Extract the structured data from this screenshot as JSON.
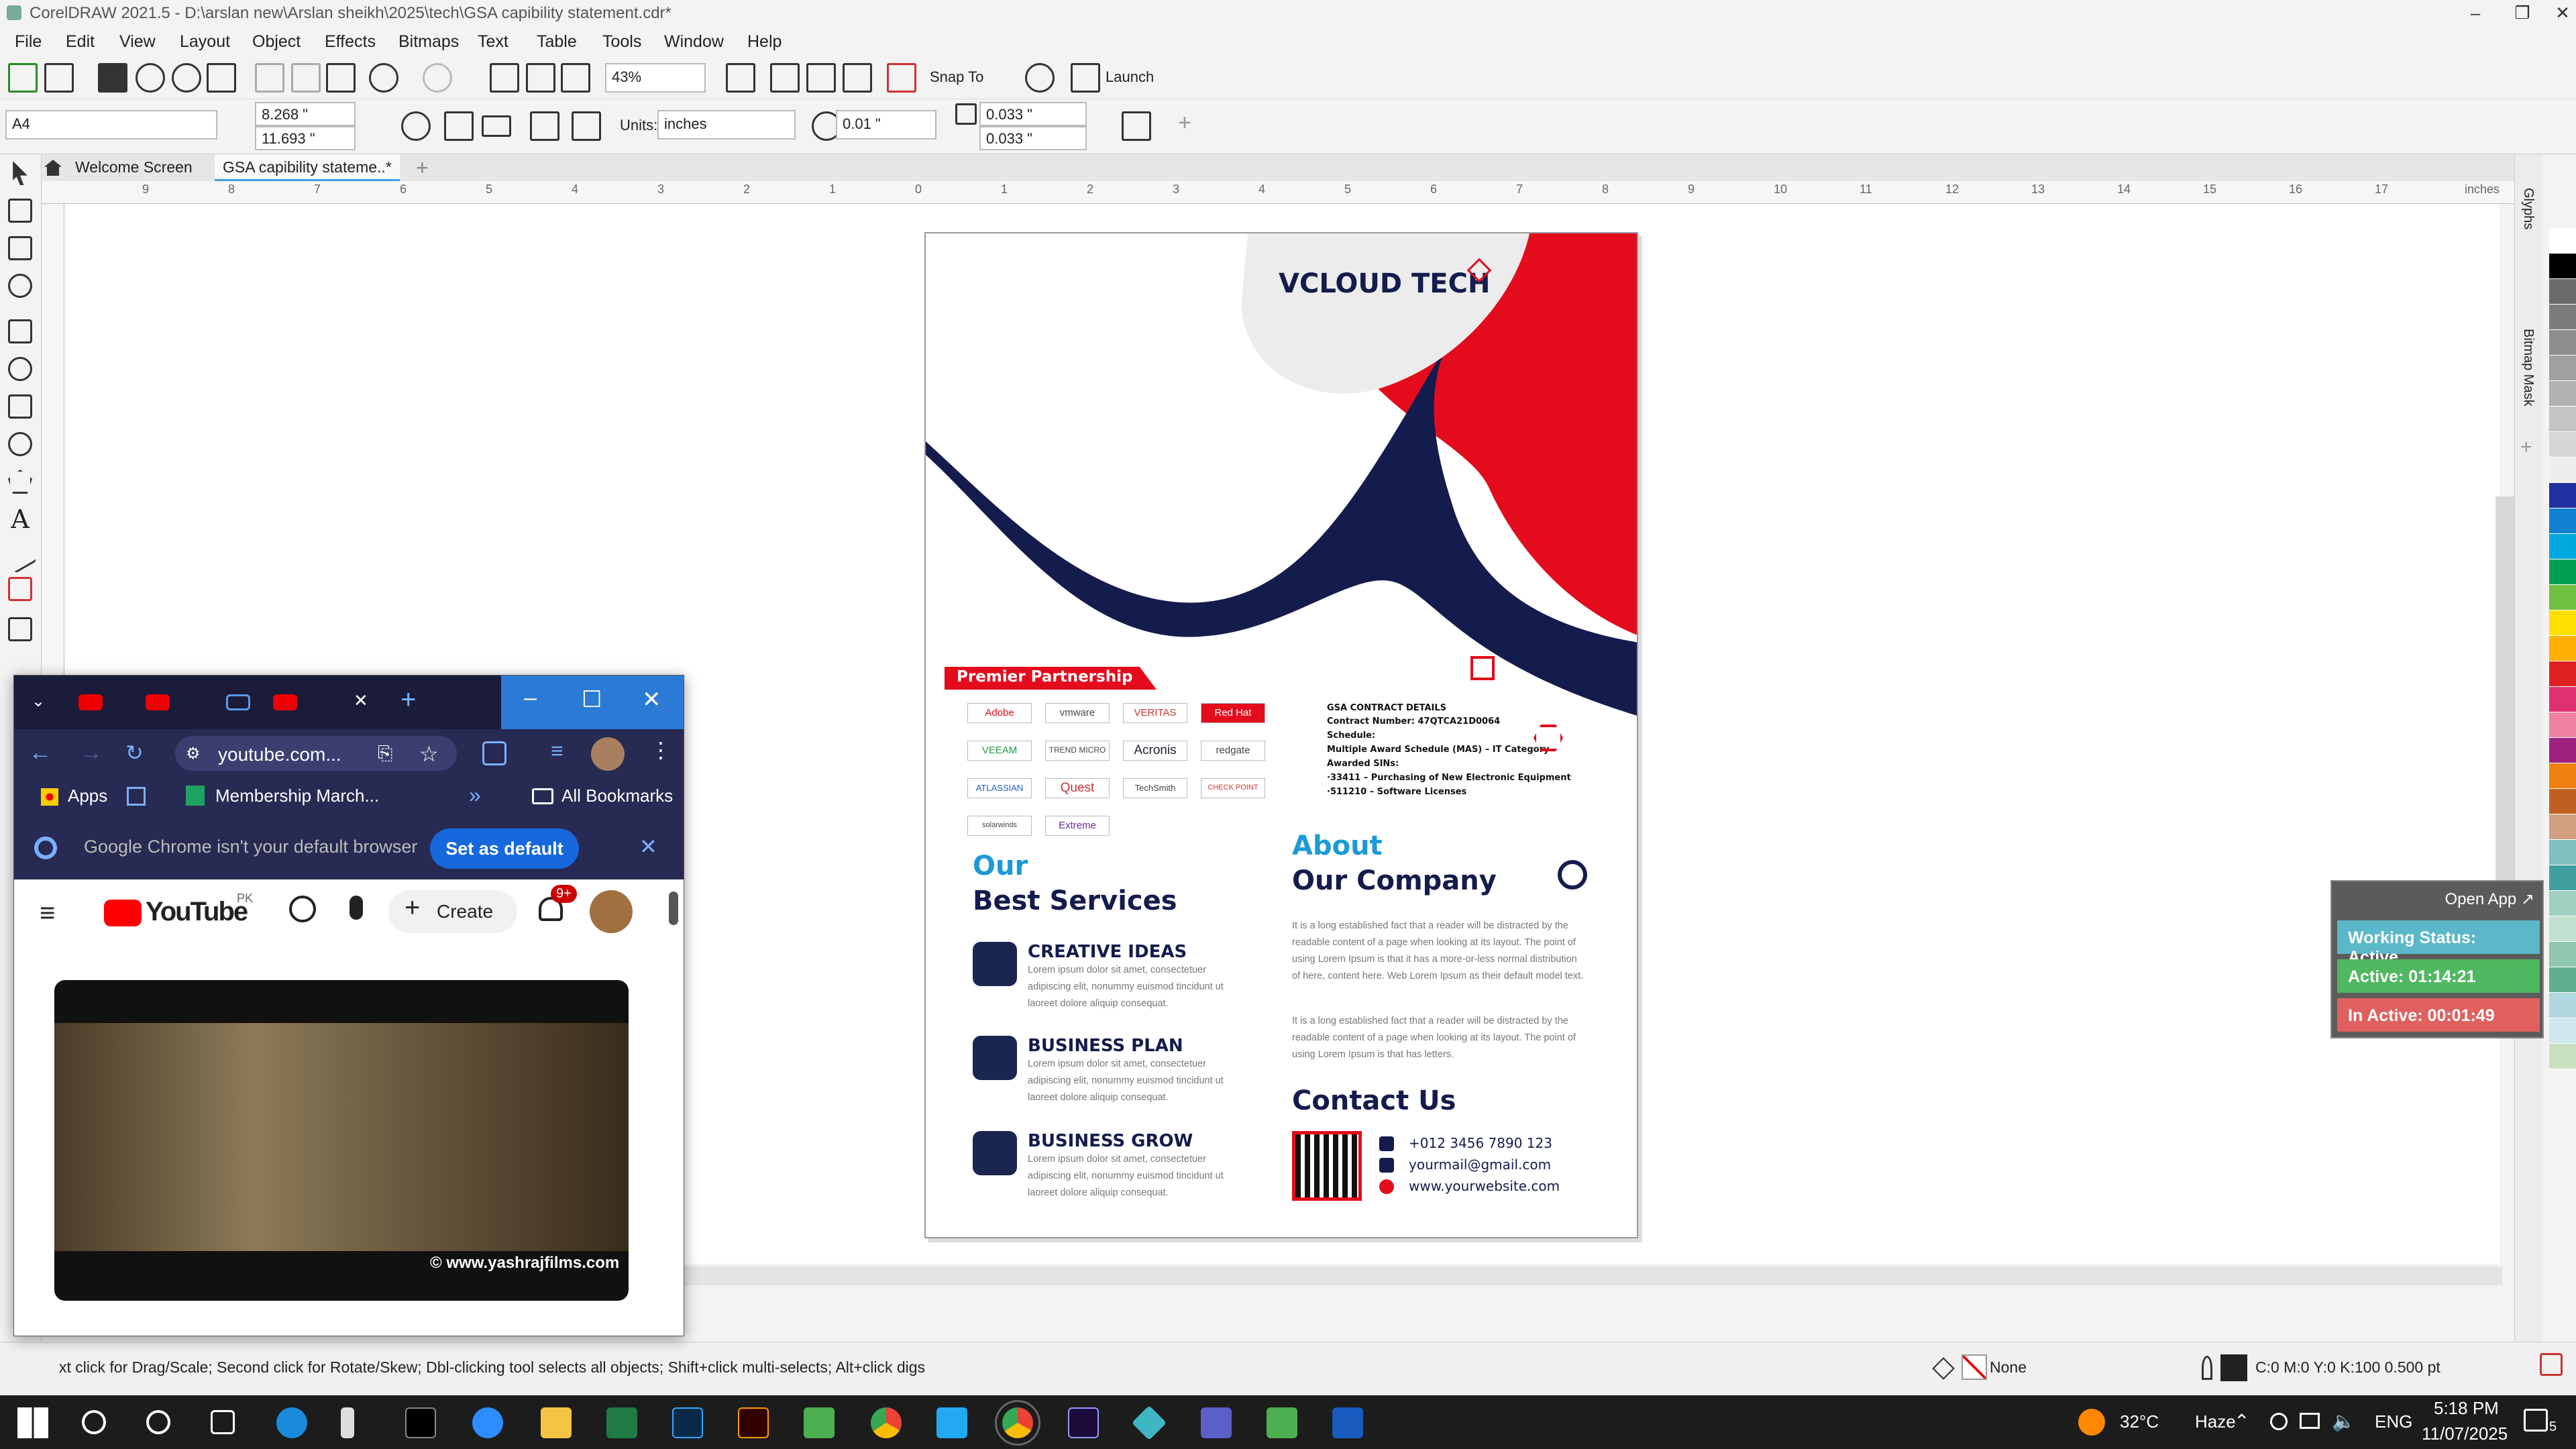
{
  "app": {
    "title": "CorelDRAW 2021.5 - D:\\arslan new\\Arslan sheikh\\2025\\tech\\GSA  capibility statement.cdr*"
  },
  "menu": [
    "File",
    "Edit",
    "View",
    "Layout",
    "Object",
    "Effects",
    "Bitmaps",
    "Text",
    "Table",
    "Tools",
    "Window",
    "Help"
  ],
  "toolbar": {
    "zoom": "43%",
    "snap_to": "Snap To",
    "launch": "Launch"
  },
  "propbar": {
    "page_size": "A4",
    "width": "8.268 \"",
    "height": "11.693 \"",
    "units_label": "Units:",
    "units": "inches",
    "nudge": "0.01 \"",
    "dup_x": "0.033 \"",
    "dup_y": "0.033 \""
  },
  "doc_tabs": [
    "Welcome Screen",
    "GSA  capibility stateme..*"
  ],
  "ruler_labels": [
    "9",
    "8",
    "7",
    "6",
    "5",
    "4",
    "3",
    "2",
    "1",
    "0",
    "1",
    "2",
    "3",
    "4",
    "5",
    "6",
    "7",
    "8",
    "9",
    "10",
    "11",
    "12",
    "13",
    "14",
    "15",
    "16",
    "17",
    "inches"
  ],
  "dockers": [
    "Glyphs",
    "Bitmap Mask"
  ],
  "palette_colors": [
    "#ffffff",
    "#000000",
    "#6a6a6a",
    "#7c7c7c",
    "#8e8e8e",
    "#a0a0a0",
    "#b2b2b2",
    "#c4c4c4",
    "#d6d6d6",
    "#eeeeee",
    "#2030a0",
    "#1080d0",
    "#00a8e0",
    "#00a050",
    "#70c040",
    "#ffe000",
    "#ffb000",
    "#e02020",
    "#e03070",
    "#f080a0",
    "#a02080",
    "#f08010",
    "#c06020",
    "#d0a080",
    "#80c0c0",
    "#40a0a0",
    "#a0d0c0",
    "#c0e0d0",
    "#90c8b0",
    "#60b090",
    "#b0d8e0",
    "#d0e8f0",
    "#c8e0c0"
  ],
  "status": {
    "hint": "xt click for Drag/Scale; Second click for Rotate/Skew; Dbl-clicking tool selects all objects; Shift+click multi-selects; Alt+click digs",
    "fill": "None",
    "outline": "C:0 M:0 Y:0 K:100  0.500 pt"
  },
  "taskbar": {
    "weather_temp": "32°C",
    "weather": "Haze",
    "lang": "ENG",
    "time": "5:18 PM",
    "date": "11/07/2025",
    "notif": "5"
  },
  "chrome": {
    "url": "youtube.com...",
    "bm_apps": "Apps",
    "bm_item": "Membership March...",
    "bm_all": "All Bookmarks",
    "info": "Google Chrome isn't your default browser",
    "set_default": "Set as default",
    "yt_brand": "YouTube",
    "yt_region": "PK",
    "yt_create": "Create",
    "yt_notif": "9+",
    "video_watermark": "© www.yashrajfilms.com"
  },
  "tracker": {
    "open_app": "Open App ↗",
    "status": "Working Status: Active",
    "active": "Active: 01:14:21",
    "inactive": "In Active: 00:01:49"
  },
  "doc": {
    "logo": "VCLOUD TECH",
    "partnership": "Premier Partnership",
    "partners": [
      "Adobe",
      "vmware",
      "VERITAS",
      "Red Hat",
      "VEEAM",
      "TREND MICRO",
      "Acronis",
      "redgate",
      "ATLASSIAN",
      "Quest",
      "TechSmith",
      "CHECK POINT",
      "solarwinds",
      "Extreme"
    ],
    "gsa_title": "GSA CONTRACT DETAILS",
    "gsa_lines": [
      "Contract Number: 47QTCA21D0064",
      "Schedule:",
      "Multiple Award Schedule (MAS) – IT Category",
      "Awarded SINs:",
      "·33411 – Purchasing of New Electronic Equipment",
      "·511210 – Software Licenses"
    ],
    "services_title1": "Our",
    "services_title2": "Best Services",
    "services": [
      {
        "title": "CREATIVE IDEAS",
        "text": "Lorem ipsum dolor sit amet, consectetuer adipiscing elit, nonummy euismod tincidunt ut laoreet dolore aliquip consequat."
      },
      {
        "title": "BUSINESS PLAN",
        "text": "Lorem ipsum dolor sit amet, consectetuer adipiscing elit, nonummy euismod tincidunt ut laoreet dolore aliquip consequat."
      },
      {
        "title": "BUSINESS GROW",
        "text": "Lorem ipsum dolor sit amet, consectetuer adipiscing elit, nonummy euismod tincidunt ut laoreet dolore aliquip consequat."
      }
    ],
    "about1": "About",
    "about2": "Our Company",
    "about_p1": "It is a long established fact that a reader will be distracted by the readable content of a page when looking at its layout. The point of using Lorem Ipsum is that it has a more-or-less normal distribution of here, content here. Web Lorem Ipsum as their default model text.",
    "about_p2": "It is a long established fact that a reader will be distracted by the readable content of a page when looking at its layout. The point of using Lorem Ipsum is that has letters.",
    "contact_title": "Contact Us",
    "phone": "+012 3456 7890 123",
    "email": "yourmail@gmail.com",
    "website": "www.yourwebsite.com"
  }
}
